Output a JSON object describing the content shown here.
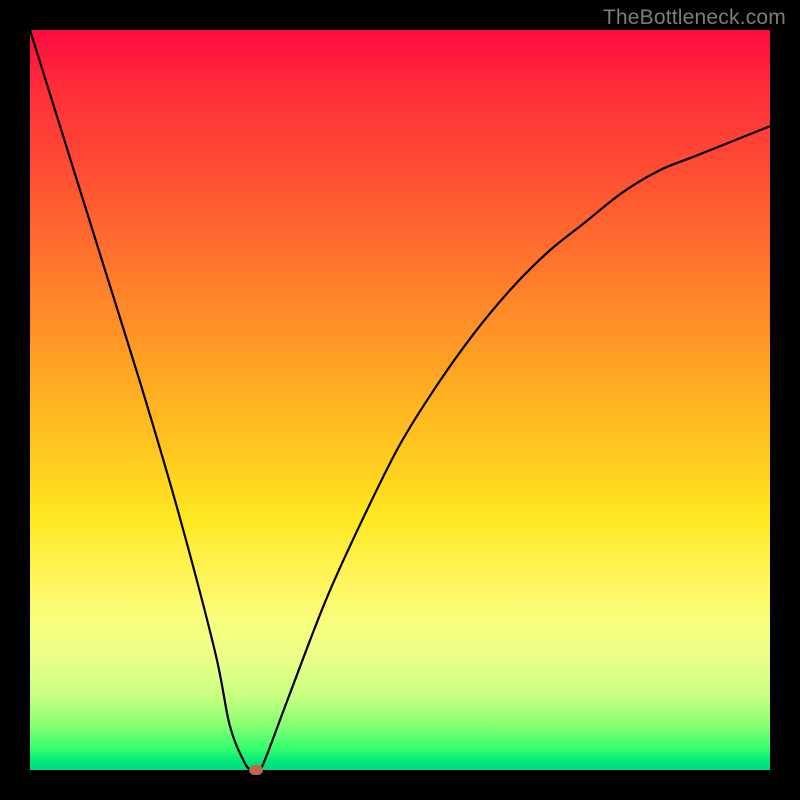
{
  "watermark": "TheBottleneck.com",
  "chart_data": {
    "type": "line",
    "title": "",
    "xlabel": "",
    "ylabel": "",
    "xlim": [
      0,
      100
    ],
    "ylim": [
      0,
      100
    ],
    "grid": false,
    "legend": false,
    "background": "red-to-green vertical gradient",
    "series": [
      {
        "name": "bottleneck-curve",
        "color": "#000000",
        "x": [
          0,
          5,
          10,
          15,
          20,
          25,
          27,
          29,
          30,
          31,
          32,
          35,
          40,
          45,
          50,
          55,
          60,
          65,
          70,
          75,
          80,
          85,
          90,
          95,
          100
        ],
        "y": [
          100,
          84,
          68,
          52,
          35,
          16,
          6,
          1,
          0,
          0,
          2,
          10,
          23,
          34,
          44,
          52,
          59,
          65,
          70,
          74,
          78,
          81,
          83,
          85,
          87
        ]
      }
    ],
    "marker": {
      "x": 30.5,
      "y": 0,
      "color": "#c0654e"
    }
  },
  "gradient_stops": [
    {
      "pos": 0,
      "color": "#ff0a3f"
    },
    {
      "pos": 50,
      "color": "#ffcb1f"
    },
    {
      "pos": 80,
      "color": "#f8ff7e"
    },
    {
      "pos": 100,
      "color": "#00d982"
    }
  ]
}
